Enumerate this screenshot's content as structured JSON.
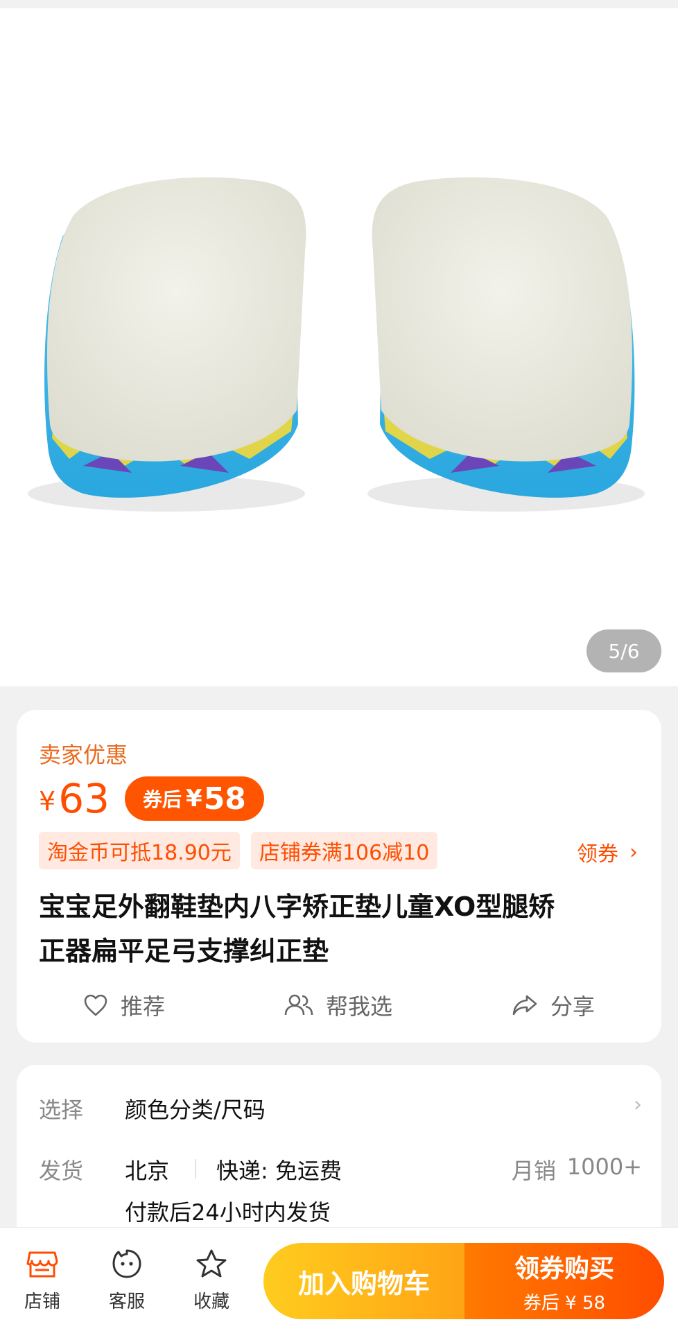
{
  "gallery": {
    "indicator": "5/6"
  },
  "price_card": {
    "seller_label": "卖家优惠",
    "price_symbol": "¥",
    "price": "63",
    "coupon_price_label": "券后",
    "coupon_price_symbol": "¥",
    "coupon_price": "58",
    "promos": [
      "淘金币可抵18.90元",
      "店铺券满106减10"
    ],
    "get_coupon": "领券",
    "title_line1": "宝宝足外翻鞋垫内八字矫正垫儿童XO型腿矫",
    "title_line2": "正器扁平足弓支撑纠正垫",
    "actions": {
      "recommend": "推荐",
      "help_choose": "帮我选",
      "share": "分享"
    }
  },
  "details": {
    "select_key": "选择",
    "select_value": "颜色分类/尺码",
    "ship_key": "发货",
    "ship_origin": "北京",
    "ship_method": "快递: 免运费",
    "monthly_sales_label": "月销",
    "monthly_sales_value": "1000+",
    "ship_time": "付款后24小时内发货"
  },
  "bottom_bar": {
    "store": "店铺",
    "service": "客服",
    "favorite": "收藏",
    "add_to_cart": "加入购物车",
    "buy_main": "领券购买",
    "buy_sub": "券后 ¥ 58"
  },
  "colors": {
    "accent": "#ff4d00",
    "seller_orange": "#ea6a1d",
    "cart_yellow": "#ffb51a"
  }
}
